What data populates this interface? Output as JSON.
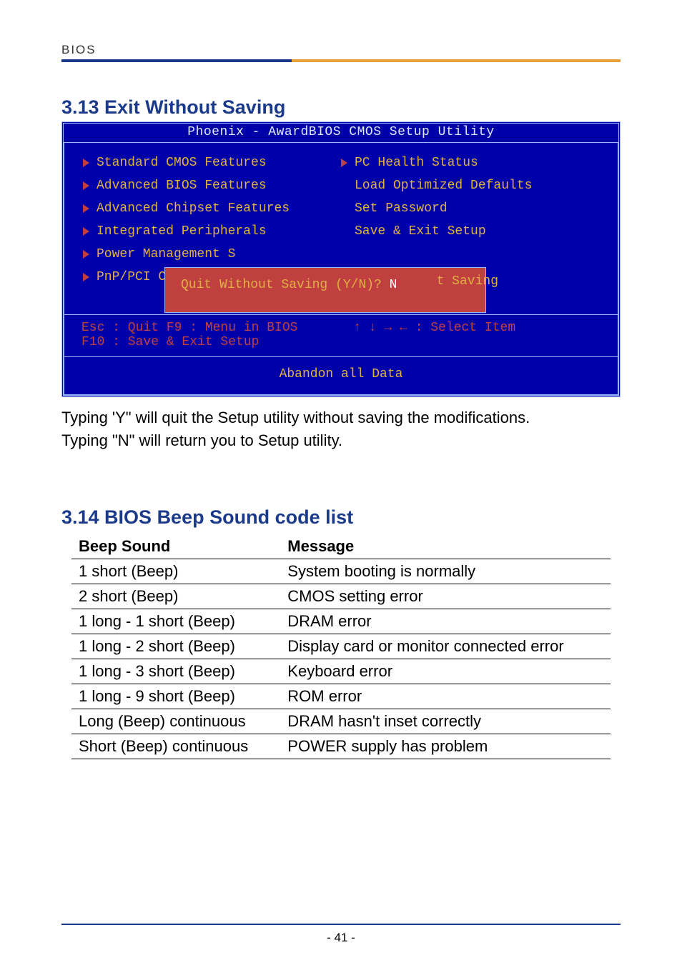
{
  "header": {
    "label": "BIOS"
  },
  "section1": {
    "title": "3.13 Exit Without Saving",
    "bios_title": "Phoenix - AwardBIOS CMOS Setup Utility",
    "left_items": [
      "Standard CMOS Features",
      "Advanced BIOS Features",
      "Advanced Chipset Features",
      "Integrated Peripherals",
      "Power Management S",
      "PnP/PCI Configurat"
    ],
    "right_items_arrow": [
      "PC Health Status"
    ],
    "right_items_plain": [
      "Load Optimized Defaults",
      "Set Password",
      "Save & Exit Setup"
    ],
    "t_saving": "t Saving",
    "dialog_text": "Quit Without Saving (Y/N)? ",
    "dialog_answer": "N",
    "keys_left": "Esc : Quit    F9 : Menu in BIOS",
    "keys_right": "↑ ↓ → ←   : Select Item",
    "keys_2": "F10 : Save & Exit Setup",
    "footer": "Abandon all Data",
    "body1": "Typing 'Y\" will quit the Setup utility without saving the modifications.",
    "body2": "Typing \"N\" will return you to Setup utility."
  },
  "section2": {
    "title": "3.14 BIOS Beep Sound code list",
    "table": {
      "head": {
        "c1": "Beep Sound",
        "c2": "Message"
      },
      "rows": [
        {
          "c1": "1 short (Beep)",
          "c2": "System booting is normally"
        },
        {
          "c1": "2 short (Beep)",
          "c2": "CMOS setting error"
        },
        {
          "c1": "1 long - 1 short (Beep)",
          "c2": "DRAM error"
        },
        {
          "c1": "1 long - 2 short (Beep)",
          "c2": "Display card or monitor connected error"
        },
        {
          "c1": "1 long - 3 short (Beep)",
          "c2": "Keyboard error"
        },
        {
          "c1": "1 long - 9 short (Beep)",
          "c2": "ROM error"
        },
        {
          "c1": "Long (Beep) continuous",
          "c2": "DRAM hasn't inset correctly"
        },
        {
          "c1": "Short (Beep) continuous",
          "c2": "POWER supply has problem"
        }
      ]
    }
  },
  "page_number": "- 41 -"
}
